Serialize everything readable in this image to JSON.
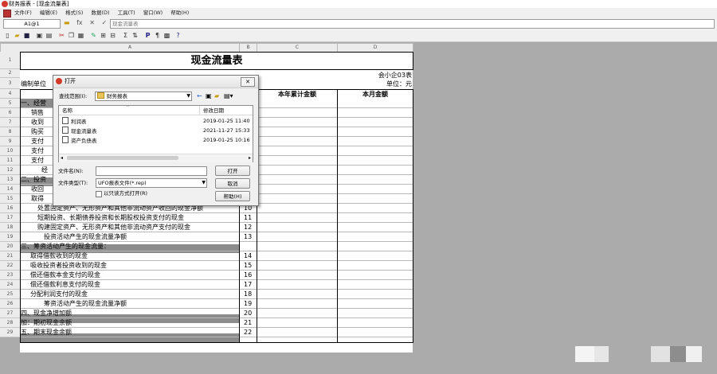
{
  "window": {
    "title": "财务报表 - [现金流量表]"
  },
  "menu": {
    "items": [
      "文件(F)",
      "编辑(E)",
      "格式(S)",
      "数据(D)",
      "工具(T)",
      "窗口(W)",
      "帮助(H)"
    ]
  },
  "formula": {
    "cell_ref": "A1@1",
    "buttons": [
      "fx",
      "✕",
      "✓"
    ],
    "value": "现金流量表"
  },
  "columns": [
    "A",
    "B",
    "C",
    "D"
  ],
  "report": {
    "title": "现金流量表",
    "form_no": "会小企03表",
    "unit": "单位：元",
    "company_label": "编制单位",
    "col_year": "本年累计金额",
    "col_month": "本月金额"
  },
  "rows": [
    {
      "r": "1",
      "a": "",
      "b": ""
    },
    {
      "r": "2",
      "a": "",
      "b": ""
    },
    {
      "r": "3",
      "a": "",
      "b": ""
    },
    {
      "r": "4",
      "a": "",
      "b": ""
    },
    {
      "r": "5",
      "a": "一、经营",
      "b": ""
    },
    {
      "r": "6",
      "a": "销售",
      "b": ""
    },
    {
      "r": "7",
      "a": "收到",
      "b": ""
    },
    {
      "r": "8",
      "a": "购买",
      "b": ""
    },
    {
      "r": "9",
      "a": "支付",
      "b": ""
    },
    {
      "r": "10",
      "a": "支付",
      "b": ""
    },
    {
      "r": "11",
      "a": "支付",
      "b": ""
    },
    {
      "r": "12",
      "a": "经",
      "b": ""
    },
    {
      "r": "13",
      "a": "二、投资",
      "b": ""
    },
    {
      "r": "14",
      "a": "收回",
      "b": ""
    },
    {
      "r": "15",
      "a": "取得",
      "b": ""
    },
    {
      "r": "16",
      "a": "处置固定资产、无形资产和其他非流动资产收回的现金净额",
      "b": "10"
    },
    {
      "r": "17",
      "a": "短期投资、长期债券投资和长期股权投资支付的现金",
      "b": "11"
    },
    {
      "r": "18",
      "a": "购建固定资产、无形资产和其他非流动资产支付的现金",
      "b": "12"
    },
    {
      "r": "19",
      "a": "投资活动产生的现金流量净额",
      "b": "13"
    },
    {
      "r": "20",
      "a": "三、筹资活动产生的现金流量：",
      "b": ""
    },
    {
      "r": "21",
      "a": "取得借款收到的现金",
      "b": "14"
    },
    {
      "r": "22",
      "a": "吸收投资者投资收到的现金",
      "b": "15"
    },
    {
      "r": "23",
      "a": "偿还借款本金支付的现金",
      "b": "16"
    },
    {
      "r": "24",
      "a": "偿还借款利息支付的现金",
      "b": "17"
    },
    {
      "r": "25",
      "a": "分配利润支付的现金",
      "b": "18"
    },
    {
      "r": "26",
      "a": "筹资活动产生的现金流量净额",
      "b": "19"
    },
    {
      "r": "27",
      "a": "四、现金净增加额",
      "b": "20"
    },
    {
      "r": "28",
      "a": "加：期初现金余额",
      "b": "21"
    },
    {
      "r": "29",
      "a": "五、期末现金余额",
      "b": "22"
    }
  ],
  "dialog": {
    "title": "打开",
    "lookin_label": "查找范围(I):",
    "lookin_value": "财务报表",
    "col_name": "名称",
    "col_date": "修改日期",
    "files": [
      {
        "name": "利润表",
        "date": "2019-01-25 11:40"
      },
      {
        "name": "现金流量表",
        "date": "2021-11-27 15:33"
      },
      {
        "name": "资产负债表",
        "date": "2019-01-25 10:16"
      }
    ],
    "filename_label": "文件名(N):",
    "filename_value": "",
    "filetype_label": "文件类型(T):",
    "filetype_value": "UFO报表文件(*.rep)",
    "readonly_label": "以只读方式打开(R)",
    "btn_open": "打开",
    "btn_cancel": "取消",
    "btn_help": "帮助(H)"
  }
}
